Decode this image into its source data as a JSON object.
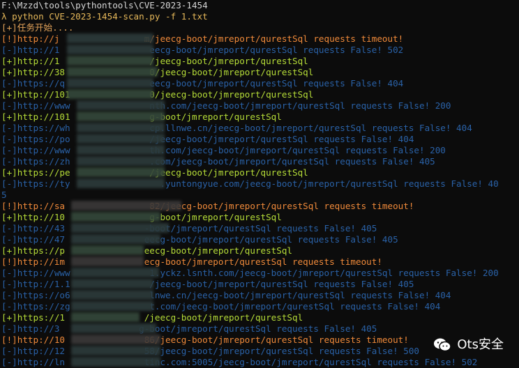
{
  "terminal": {
    "path": "F:\\Mzzd\\tools\\pythontools\\CVE-2023-1454",
    "command": "λ python CVE-2023-1454-scan.py -f 1.txt",
    "lines": [
      {
        "type": "start",
        "text": "[+]任务开始...."
      },
      {
        "type": "timeout",
        "text": "[!]http://j                m/jeecg-boot/jmreport/qurestSql requests timeout!"
      },
      {
        "type": "fail",
        "text": "[-]http://1                 eecg-boot/jmreport/qurestSql requests False! 502"
      },
      {
        "type": "ok",
        "text": "[+]http://1                 /jeecg-boot/jmreport/qurestSql"
      },
      {
        "type": "ok",
        "text": "[+]http://38                0/jeecg-boot/jmreport/qurestSql"
      },
      {
        "type": "fail",
        "text": "[-]https://q                eecg-boot/jmreport/qurestSql requests False! 404"
      },
      {
        "type": "ok",
        "text": "[+]http://101               0/jeecg-boot/jmreport/qurestSql"
      },
      {
        "type": "fail",
        "text": "[-]http://www               nth.com/jeecg-boot/jmreport/qurestSql requests False! 200"
      },
      {
        "type": "ok",
        "text": "[+]http://101               g-boot/jmreport/qurestSql"
      },
      {
        "type": "fail",
        "text": "[-]https://wh               cp.llnwe.cn/jeecg-boot/jmreport/qurestSql requests False! 404"
      },
      {
        "type": "fail",
        "text": "[-]https://po               /jeecg-boot/jmreport/qurestSql requests False! 404"
      },
      {
        "type": "fail",
        "text": "[-]http://www               th.com/jeecg-boot/jmreport/qurestSql requests False! 200"
      },
      {
        "type": "fail",
        "text": "[-]https://zh               .com/jeecg-boot/jmreport/qurestSql requests False! 405"
      },
      {
        "type": "ok",
        "text": "[+]https://pe               /jeecg-boot/jmreport/qurestSql"
      },
      {
        "type": "fail",
        "text": "[-]https://ty                 .yuntongyue.com/jeecg-boot/jmreport/qurestSql requests False! 40"
      },
      {
        "type": "fail",
        "text": "5"
      },
      {
        "type": "timeout",
        "text": "[!]http://sa                82/jeecg-boot/jmreport/qurestSql requests timeout!"
      },
      {
        "type": "ok",
        "text": "[+]http://10                g-boot/jmreport/qurestSql"
      },
      {
        "type": "fail",
        "text": "[-]http://43               -boot/jmreport/qurestSql requests False! 405"
      },
      {
        "type": "fail",
        "text": "[-]http://47               eecg-boot/jmreport/qurestSql requests False! 405"
      },
      {
        "type": "ok",
        "text": "[+]https://p               eecg-boot/jmreport/qurestSql"
      },
      {
        "type": "timeout",
        "text": "[!]http://im               ecg-boot/jmreport/qurestSql requests timeout!"
      },
      {
        "type": "fail",
        "text": "[-]http://www               1.yckz.lsnth.com/jeecg-boot/jmreport/qurestSql requests False! 200"
      },
      {
        "type": "fail",
        "text": "[-]http://1.1               /jeecg-boot/jmreport/qurestSql requests False! 405"
      },
      {
        "type": "fail",
        "text": "[-]https://o6               lnwe.cn/jeecg-boot/jmreport/qurestSql requests False! 404"
      },
      {
        "type": "fail",
        "text": "[-]https://zg               t.com/jeecg-boot/jmreport/qurestSql requests False! 404"
      },
      {
        "type": "ok",
        "text": "[+]https://1               /jeecg-boot/jmreport/qurestSql"
      },
      {
        "type": "fail",
        "text": "[-]http://3               g-boot/jmreport/qurestSql requests False! 405"
      },
      {
        "type": "timeout",
        "text": "[!]http://10               86/jeecg-boot/jmreport/qurestSql requests timeout!"
      },
      {
        "type": "fail",
        "text": "[-]http://12               58/jeecg-boot/jmreport/qurestSql requests False! 500"
      },
      {
        "type": "fail",
        "text": "[-]http://ln               tinc.com:5005/jeecg-boot/jmreport/qurestSql requests False! 502"
      }
    ]
  },
  "watermark": {
    "icon": "wechat-icon",
    "text": "Ots安全"
  },
  "colors": {
    "background": "#0c0c0c",
    "ok": "#b6dd38",
    "fail": "#2a62a8",
    "timeout": "#f08a3a"
  }
}
